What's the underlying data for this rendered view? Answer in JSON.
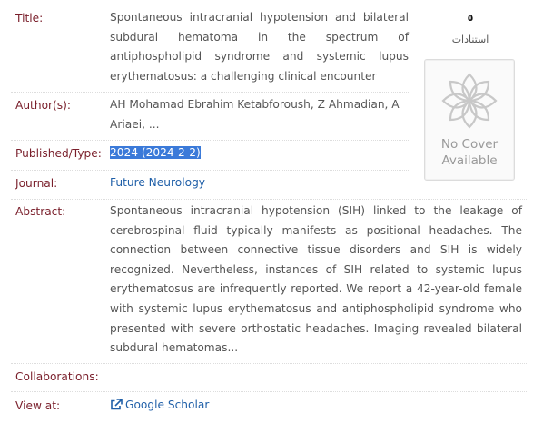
{
  "labels": {
    "title": "Title:",
    "authors": "Author(s):",
    "published": "Published/Type:",
    "journal": "Journal:",
    "abstract": "Abstract:",
    "collaborations": "Collaborations:",
    "view_at": "View at:"
  },
  "record": {
    "title": "Spontaneous intracranial hypotension and bilateral subdural hematoma in the spectrum of antiphospholipid syndrome and systemic lupus erythematosus: a challenging clinical encounter",
    "authors": "AH Mohamad Ebrahim Ketabforoush, Z Ahmadian, A Ariaei, ...",
    "published": "2024 (2024-2-2)",
    "journal": "Future Neurology",
    "abstract": "Spontaneous intracranial hypotension (SIH) linked to the leakage of cerebrospinal fluid typically manifests as positional headaches. The connection between connective tissue disorders and SIH is widely recognized. Nevertheless, instances of SIH related to systemic lupus erythematosus are infrequently reported. We report a 42-year-old female with systemic lupus erythematosus and antiphospholipid syndrome who presented with severe orthostatic headaches. Imaging revealed bilateral subdural hematomas...",
    "collaborations": "",
    "view_at_link": "Google Scholar"
  },
  "citations": {
    "count": "٥",
    "label": "استنادات"
  },
  "cover": {
    "line1": "No Cover",
    "line2": "Available"
  },
  "colors": {
    "label": "#7a1f2b",
    "link": "#1f5fa8",
    "selection": "#3b7ad9"
  },
  "icons": {
    "external_link": "external-link-icon",
    "cover_placeholder": "flower-ornament-icon"
  }
}
